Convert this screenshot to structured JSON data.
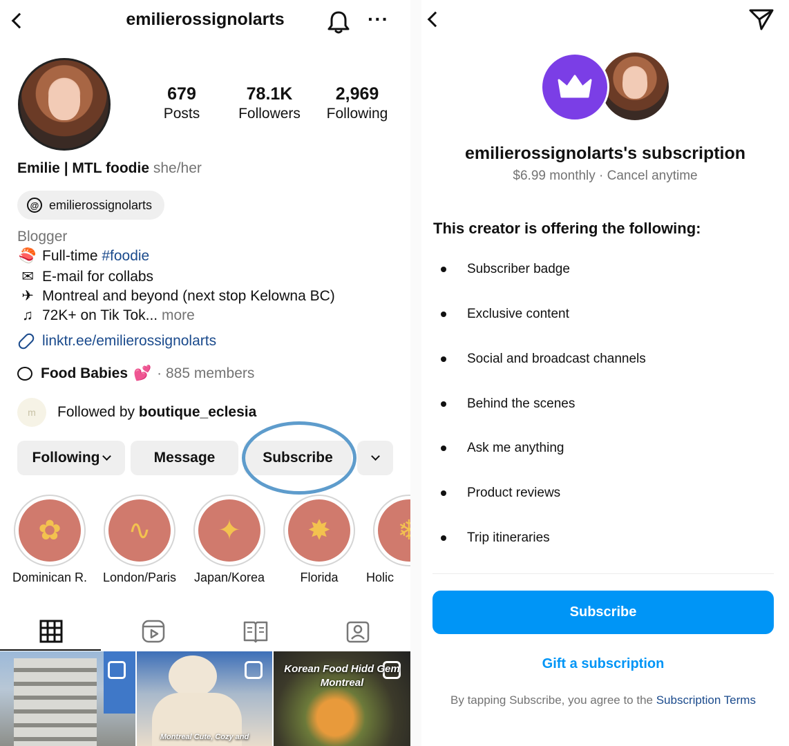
{
  "profile": {
    "username": "emilierossignolarts",
    "stats": [
      {
        "num": "679",
        "label": "Posts"
      },
      {
        "num": "78.1K",
        "label": "Followers"
      },
      {
        "num": "2,969",
        "label": "Following"
      }
    ],
    "display_name": "Emilie | MTL foodie",
    "pronouns": "she/her",
    "threads_handle": "emilierossignolarts",
    "category": "Blogger",
    "bio": {
      "line1_text": "Full-time ",
      "line1_hashtag": "#foodie",
      "line2": "E-mail for collabs",
      "line3": "Montreal and beyond (next stop Kelowna BC)",
      "line4": "72K+ on Tik Tok...",
      "more": "more"
    },
    "link": "linktr.ee/emilierossignolarts",
    "channel": {
      "name": "Food Babies",
      "members": "· 885 members"
    },
    "followed_by": {
      "prefix": "Followed by ",
      "user": "boutique_eclesia"
    },
    "buttons": {
      "following": "Following",
      "message": "Message",
      "subscribe": "Subscribe"
    },
    "highlights": [
      "Dominican R.",
      "London/Paris",
      "Japan/Korea",
      "Florida",
      "Holic"
    ],
    "grid_posts": [
      "Korean Food Hidd Gem Montreal",
      "Montreal Cute, Cozy and"
    ]
  },
  "subscription": {
    "title": "emilierossignolarts's subscription",
    "price": "$6.99 monthly · Cancel anytime",
    "heading": "This creator is offering the following:",
    "benefits": [
      "Subscriber badge",
      "Exclusive content",
      "Social and broadcast channels",
      "Behind the scenes",
      "Ask me anything",
      "Product reviews",
      "Trip itineraries"
    ],
    "cta": "Subscribe",
    "gift": "Gift a subscription",
    "terms_prefix": "By tapping Subscribe, you agree to the ",
    "terms_link": "Subscription Terms"
  },
  "colors": {
    "accent_blue": "#0095f6",
    "crown_purple": "#7b3ee6",
    "highlight_ring": "#5e9ccc",
    "link_blue": "#1a4a8c"
  }
}
